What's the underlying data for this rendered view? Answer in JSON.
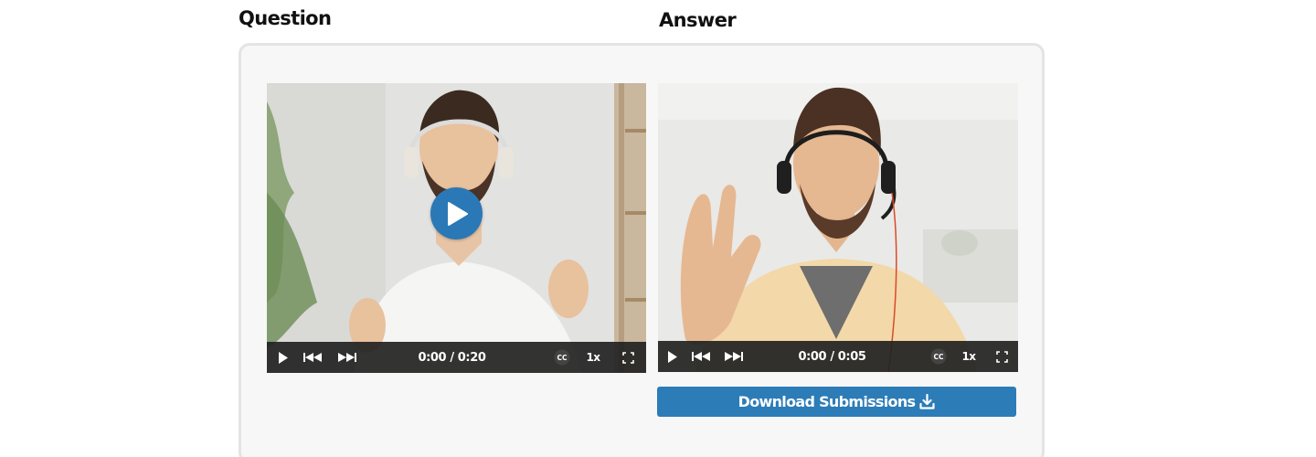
{
  "question": {
    "heading": "Question",
    "video": {
      "time": "0:00 / 0:20",
      "speed": "1x",
      "cc": "CC"
    }
  },
  "answer": {
    "heading": "Answer",
    "video": {
      "time": "0:00 / 0:05",
      "speed": "1x",
      "cc": "CC"
    }
  },
  "download_button": {
    "label": "Download Submissions",
    "icon": "download-icon"
  },
  "colors": {
    "accent": "#2c7cb8",
    "play_button": "#2b78b6",
    "controls_bar": "#222222",
    "card_background": "#f7f7f7",
    "card_border": "#e4e4e4"
  }
}
